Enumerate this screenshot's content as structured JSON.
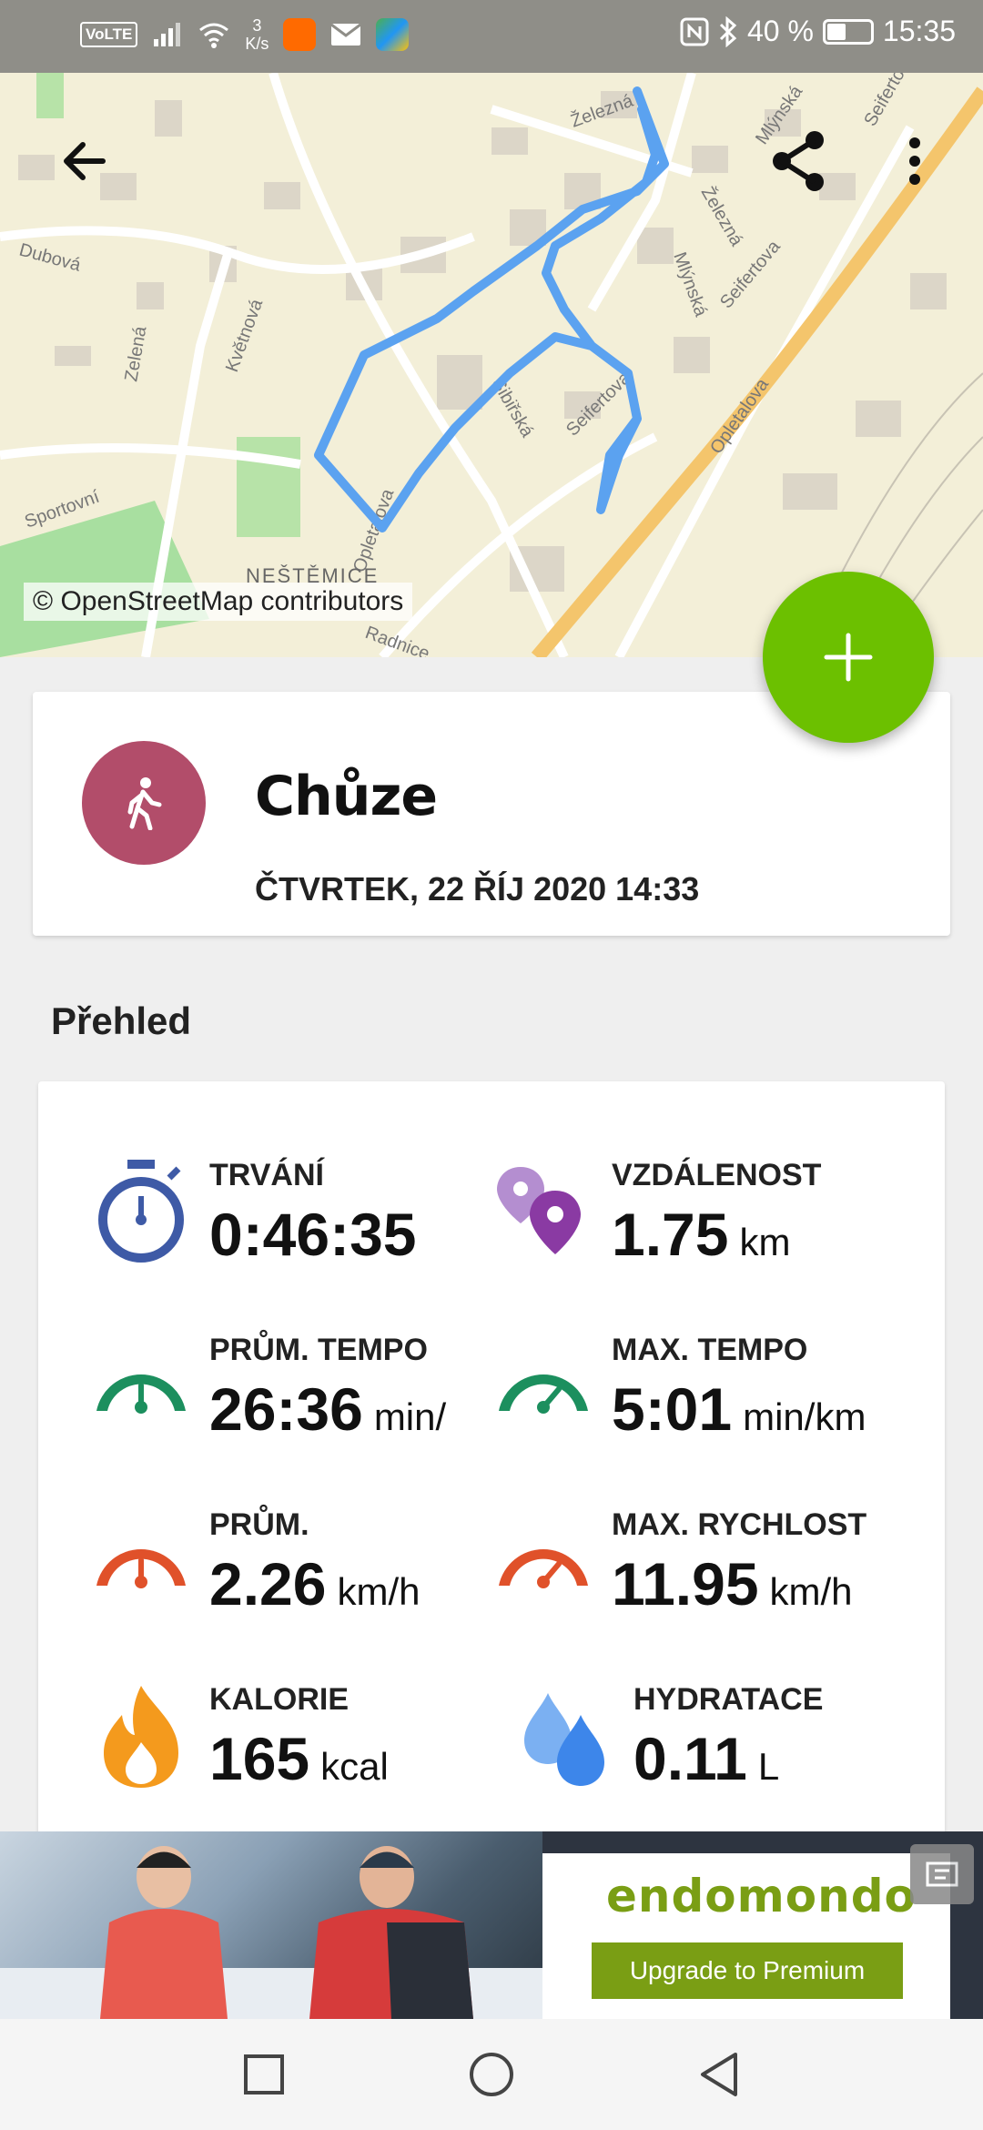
{
  "status_bar": {
    "volte": "VoLTE",
    "net_speed_value": "3",
    "net_speed_unit": "K/s",
    "battery_percent": "40 %",
    "battery_level": 0.4,
    "time": "15:35"
  },
  "map": {
    "attribution": "© OpenStreetMap contributors",
    "back_icon": "arrow-left-icon",
    "share_icon": "share-icon",
    "menu_icon": "more-vert-icon",
    "route_color": "#5ba2f0",
    "streets": [
      "Železná",
      "Mlýnská",
      "Seifertova",
      "Sibiřská",
      "Dubová",
      "Květnová",
      "Sportovní",
      "Opletalova",
      "NEŠTĚMICE",
      "Radnice",
      "Zelená"
    ]
  },
  "fab": {
    "icon": "plus-icon",
    "color": "#6cc000"
  },
  "activity": {
    "title": "Chůze",
    "date": "ČTVRTEK, 22 ŘÍJ 2020 14:33",
    "icon": "walking-person-icon",
    "color": "#b24d6a"
  },
  "overview": {
    "title": "Přehled",
    "stats": [
      {
        "label": "TRVÁNÍ",
        "value": "0:46:35",
        "unit": "",
        "icon": "stopwatch-icon"
      },
      {
        "label": "VZDÁLENOST",
        "value": "1.75",
        "unit": "km",
        "icon": "map-pins-icon"
      },
      {
        "label": "PRŮM. TEMPO",
        "value": "26:36",
        "unit": "min/",
        "icon": "speedometer-green-icon"
      },
      {
        "label": "MAX. TEMPO",
        "value": "5:01",
        "unit": "min/km",
        "icon": "speedometer-green-icon"
      },
      {
        "label": "PRŮM.",
        "value": "2.26",
        "unit": "km/h",
        "icon": "speedometer-red-icon"
      },
      {
        "label": "MAX. RYCHLOST",
        "value": "11.95",
        "unit": "km/h",
        "icon": "speedometer-red-icon"
      },
      {
        "label": "KALORIE",
        "value": "165",
        "unit": "kcal",
        "icon": "flame-icon"
      },
      {
        "label": "HYDRATACE",
        "value": "0.11",
        "unit": "L",
        "icon": "water-drops-icon"
      }
    ]
  },
  "ad": {
    "logo": "endomondo",
    "button": "Upgrade to Premium",
    "brand_color": "#7a9e14"
  },
  "nav_bar": {
    "recents_icon": "square-icon",
    "home_icon": "circle-icon",
    "back_icon": "triangle-back-icon"
  }
}
